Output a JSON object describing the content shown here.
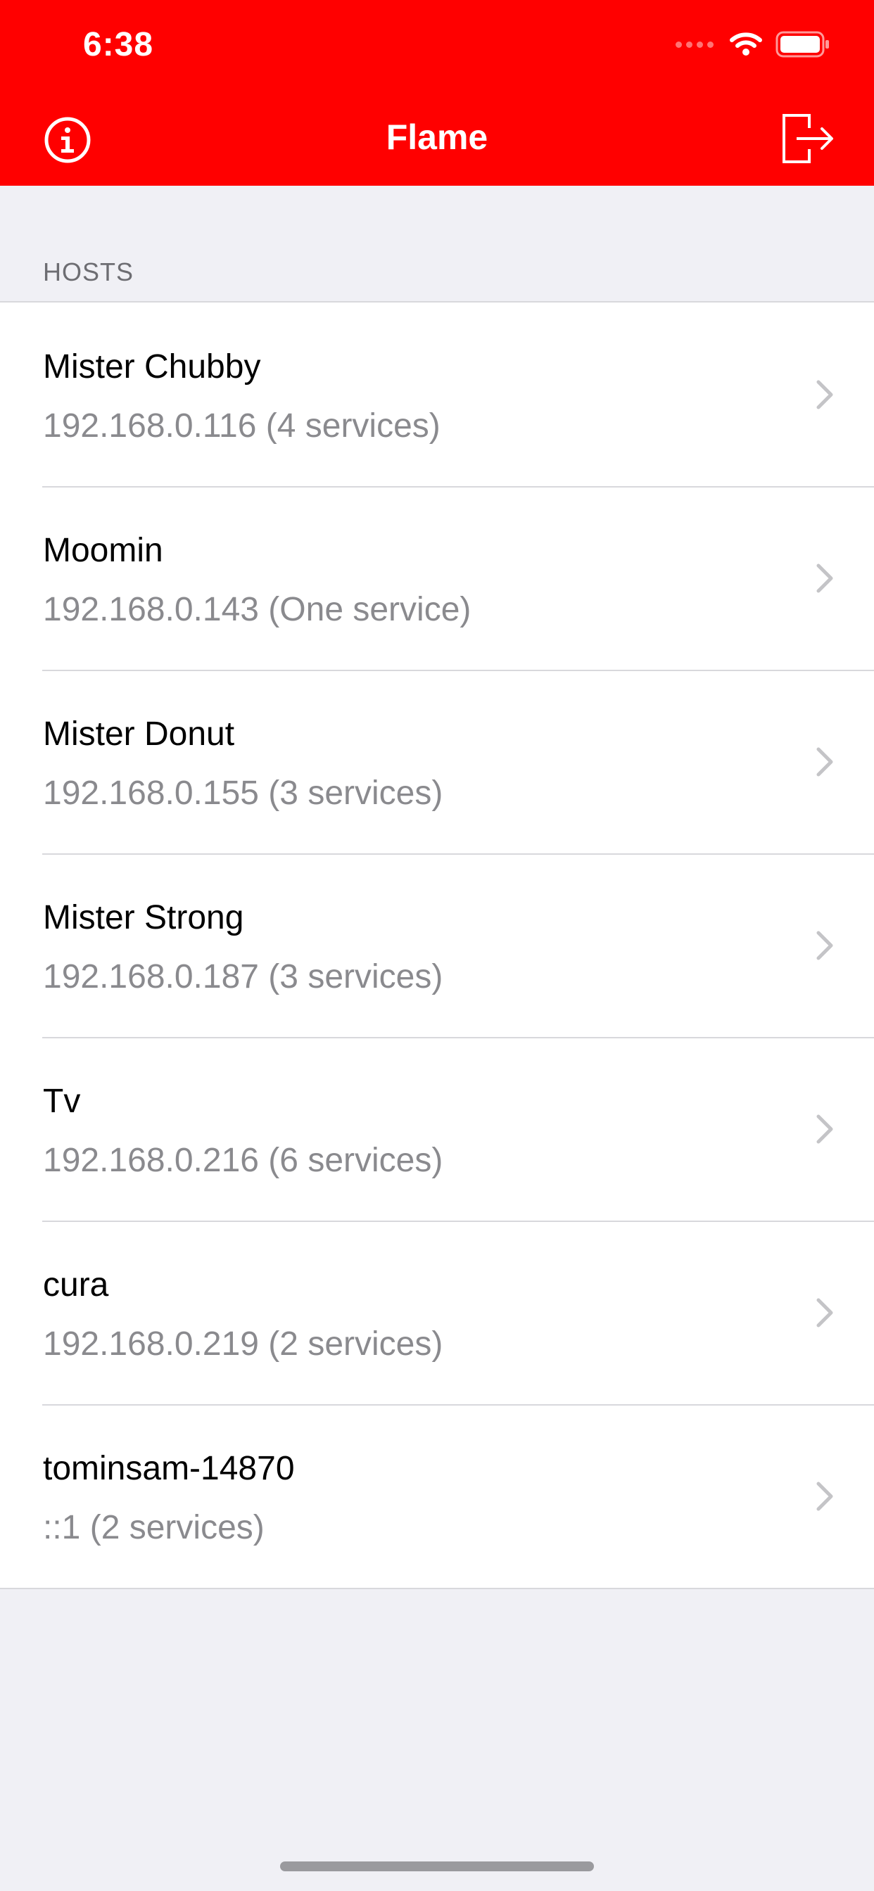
{
  "status_bar": {
    "time": "6:38"
  },
  "nav": {
    "title": "Flame",
    "info_icon": "info-circle-icon",
    "logout_icon": "logout-icon",
    "bar_color": "#ff0000"
  },
  "section": {
    "header": "HOSTS"
  },
  "hosts": [
    {
      "name": "Mister Chubby",
      "detail": "192.168.0.116 (4 services)"
    },
    {
      "name": "Moomin",
      "detail": "192.168.0.143 (One service)"
    },
    {
      "name": "Mister Donut",
      "detail": "192.168.0.155 (3 services)"
    },
    {
      "name": "Mister Strong",
      "detail": "192.168.0.187 (3 services)"
    },
    {
      "name": "Tv",
      "detail": "192.168.0.216 (6 services)"
    },
    {
      "name": "cura",
      "detail": "192.168.0.219 (2 services)"
    },
    {
      "name": "tominsam-14870",
      "detail": "::1 (2 services)"
    }
  ]
}
